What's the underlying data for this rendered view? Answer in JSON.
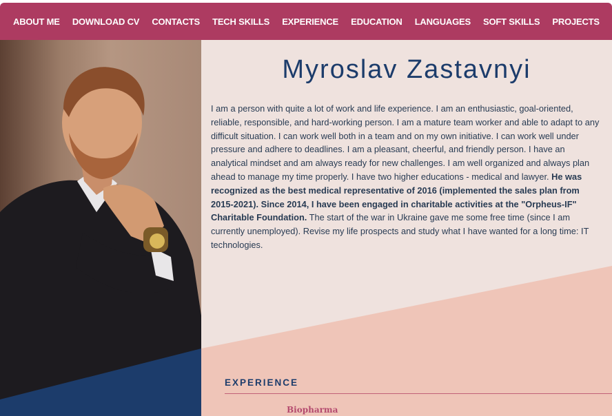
{
  "nav": {
    "items": [
      "ABOUT ME",
      "DOWNLOAD CV",
      "CONTACTS",
      "TECH SKILLS",
      "EXPERIENCE",
      "EDUCATION",
      "LANGUAGES",
      "SOFT SKILLS",
      "PROJECTS"
    ]
  },
  "profile": {
    "name": "Myroslav Zastavnyi",
    "bio_part1": "I am a person with quite a lot of work and life experience. I am an enthusiastic, goal-oriented, reliable, responsible, and hard-working person. I am a mature team worker and able to adapt to any difficult situation. I can work well both in a team and on my own initiative. I can work well under pressure and adhere to deadlines. I am a pleasant, cheerful, and friendly person. I have an analytical mindset and am always ready for new challenges. I am well organized and always plan ahead to manage my time properly. I have two higher educations - medical and lawyer. ",
    "bio_bold": "He was recognized as the best medical representative of 2016 (implemented the sales plan from 2015-2021). Since 2014, I have been engaged in charitable activities at the \"Orpheus-IF\" Charitable Foundation.",
    "bio_part2": " The start of the war in Ukraine gave me some free time (since I am currently unemployed). Revise my life prospects and study what I have wanted for a long time: IT technologies."
  },
  "experience": {
    "title": "EXPERIENCE",
    "company": "Biopharma"
  },
  "colors": {
    "nav_bg": "#ad3b61",
    "accent_blue": "#1c3c6b",
    "content_bg": "#efe2de",
    "salmon": "#efc5b8"
  }
}
